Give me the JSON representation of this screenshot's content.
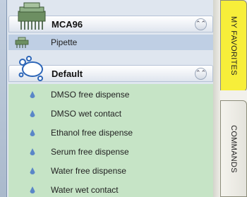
{
  "groups": [
    {
      "title": "MCA96",
      "icon": "multichannel-pipette-icon",
      "collapse_icon": "double-chevron-up-icon",
      "items": [
        {
          "label": "Pipette",
          "icon": "pipette-array-icon"
        }
      ]
    },
    {
      "title": "Default",
      "icon": "liquid-splash-icon",
      "collapse_icon": "double-chevron-up-icon",
      "items": [
        {
          "label": "DMSO free dispense",
          "icon": "droplet-icon"
        },
        {
          "label": "DMSO wet contact",
          "icon": "droplet-icon"
        },
        {
          "label": "Ethanol free dispense",
          "icon": "droplet-icon"
        },
        {
          "label": "Serum free dispense",
          "icon": "droplet-icon"
        },
        {
          "label": "Water free dispense",
          "icon": "droplet-icon"
        },
        {
          "label": "Water wet contact",
          "icon": "droplet-icon"
        }
      ]
    }
  ],
  "tabs": [
    {
      "label": "MY FAVORITES",
      "active": true,
      "color": "#f7ee3a"
    },
    {
      "label": "COMMANDS",
      "active": false
    }
  ],
  "colors": {
    "mca_items_bg": "#bfcfe4",
    "default_items_bg": "#c6e4c6",
    "droplet": "#5a86c8"
  }
}
